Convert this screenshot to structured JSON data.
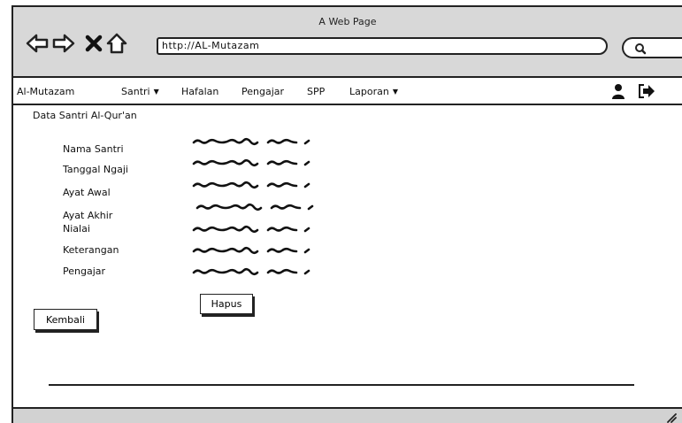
{
  "window": {
    "title": "A Web Page"
  },
  "browser": {
    "url": "http://AL-Mutazam",
    "icons": [
      "back-arrow-icon",
      "forward-arrow-icon",
      "close-icon",
      "home-icon",
      "search-icon"
    ]
  },
  "menu": {
    "brand": "Al-Mutazam",
    "items": [
      {
        "label": "Santri",
        "dropdown": true
      },
      {
        "label": "Hafalan",
        "dropdown": false
      },
      {
        "label": "Pengajar",
        "dropdown": false
      },
      {
        "label": "SPP",
        "dropdown": false
      },
      {
        "label": "Laporan",
        "dropdown": true
      }
    ],
    "icons": [
      "user-icon",
      "logout-icon"
    ]
  },
  "page": {
    "heading": "Data Santri Al-Qur'an"
  },
  "form": {
    "fields": [
      {
        "label": "Nama Santri"
      },
      {
        "label": "Tanggal Ngaji"
      },
      {
        "label": "Ayat Awal"
      },
      {
        "label": "Ayat Akhir"
      },
      {
        "label": "Nialai"
      },
      {
        "label": "Keterangan"
      },
      {
        "label": "Pengajar"
      }
    ]
  },
  "buttons": {
    "hapus": "Hapus",
    "kembali": "Kembali"
  },
  "colors": {
    "chrome": "#d8d8d8",
    "ink": "#222222",
    "background": "#ffffff"
  }
}
